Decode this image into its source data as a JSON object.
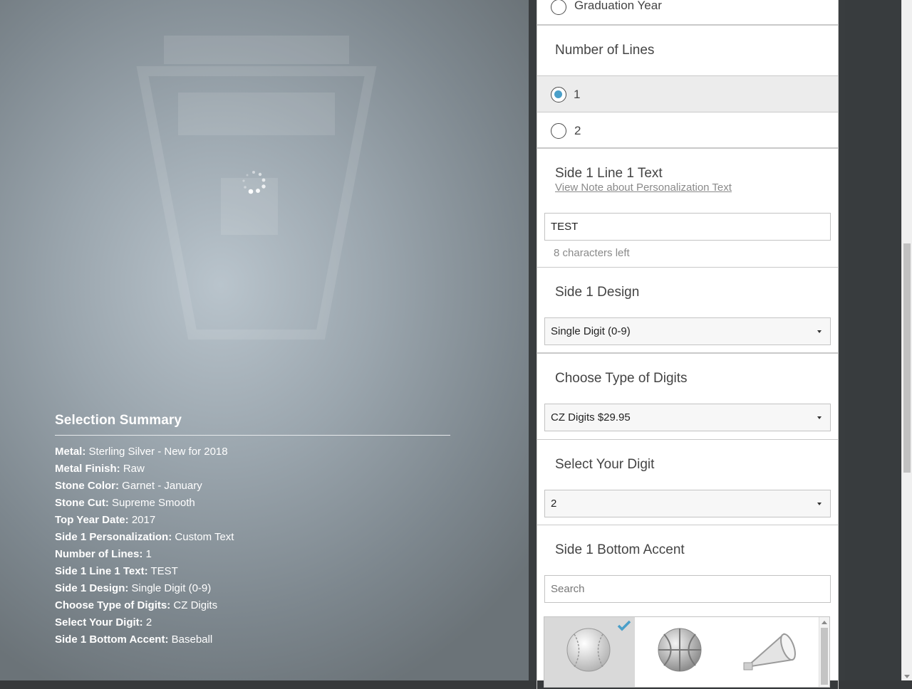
{
  "summary": {
    "title": "Selection Summary",
    "items": [
      {
        "label": "Metal:",
        "value": "Sterling Silver - New for 2018"
      },
      {
        "label": "Metal Finish:",
        "value": "Raw"
      },
      {
        "label": "Stone Color:",
        "value": "Garnet - January"
      },
      {
        "label": "Stone Cut:",
        "value": "Supreme Smooth"
      },
      {
        "label": "Top Year Date:",
        "value": "2017"
      },
      {
        "label": "Side 1 Personalization:",
        "value": "Custom Text"
      },
      {
        "label": "Number of Lines:",
        "value": "1"
      },
      {
        "label": "Side 1 Line 1 Text:",
        "value": "TEST"
      },
      {
        "label": "Side 1 Design:",
        "value": "Single Digit (0-9)"
      },
      {
        "label": "Choose Type of Digits:",
        "value": "CZ Digits"
      },
      {
        "label": "Select Your Digit:",
        "value": "2"
      },
      {
        "label": "Side 1 Bottom Accent:",
        "value": "Baseball"
      }
    ]
  },
  "options": {
    "graduation_year_label": "Graduation Year",
    "number_of_lines": {
      "title": "Number of Lines",
      "choices": [
        {
          "label": "1",
          "selected": true
        },
        {
          "label": "2",
          "selected": false
        }
      ]
    },
    "line1_text": {
      "title": "Side 1 Line 1 Text",
      "note_link": "View Note about Personalization Text",
      "value": "TEST",
      "chars_left": "8 characters left"
    },
    "side1_design": {
      "title": "Side 1 Design",
      "selected": "Single Digit (0-9)"
    },
    "digit_type": {
      "title": "Choose Type of Digits",
      "selected": "CZ Digits $29.95"
    },
    "digit": {
      "title": "Select Your Digit",
      "selected": "2"
    },
    "bottom_accent": {
      "title": "Side 1 Bottom Accent",
      "search_placeholder": "Search",
      "items": [
        {
          "icon": "baseball-icon",
          "selected": true
        },
        {
          "icon": "basketball-icon",
          "selected": false
        },
        {
          "icon": "megaphone-icon",
          "selected": false
        }
      ]
    }
  },
  "colors": {
    "accent": "#4a9fc9",
    "panel_border": "#393d3f"
  }
}
